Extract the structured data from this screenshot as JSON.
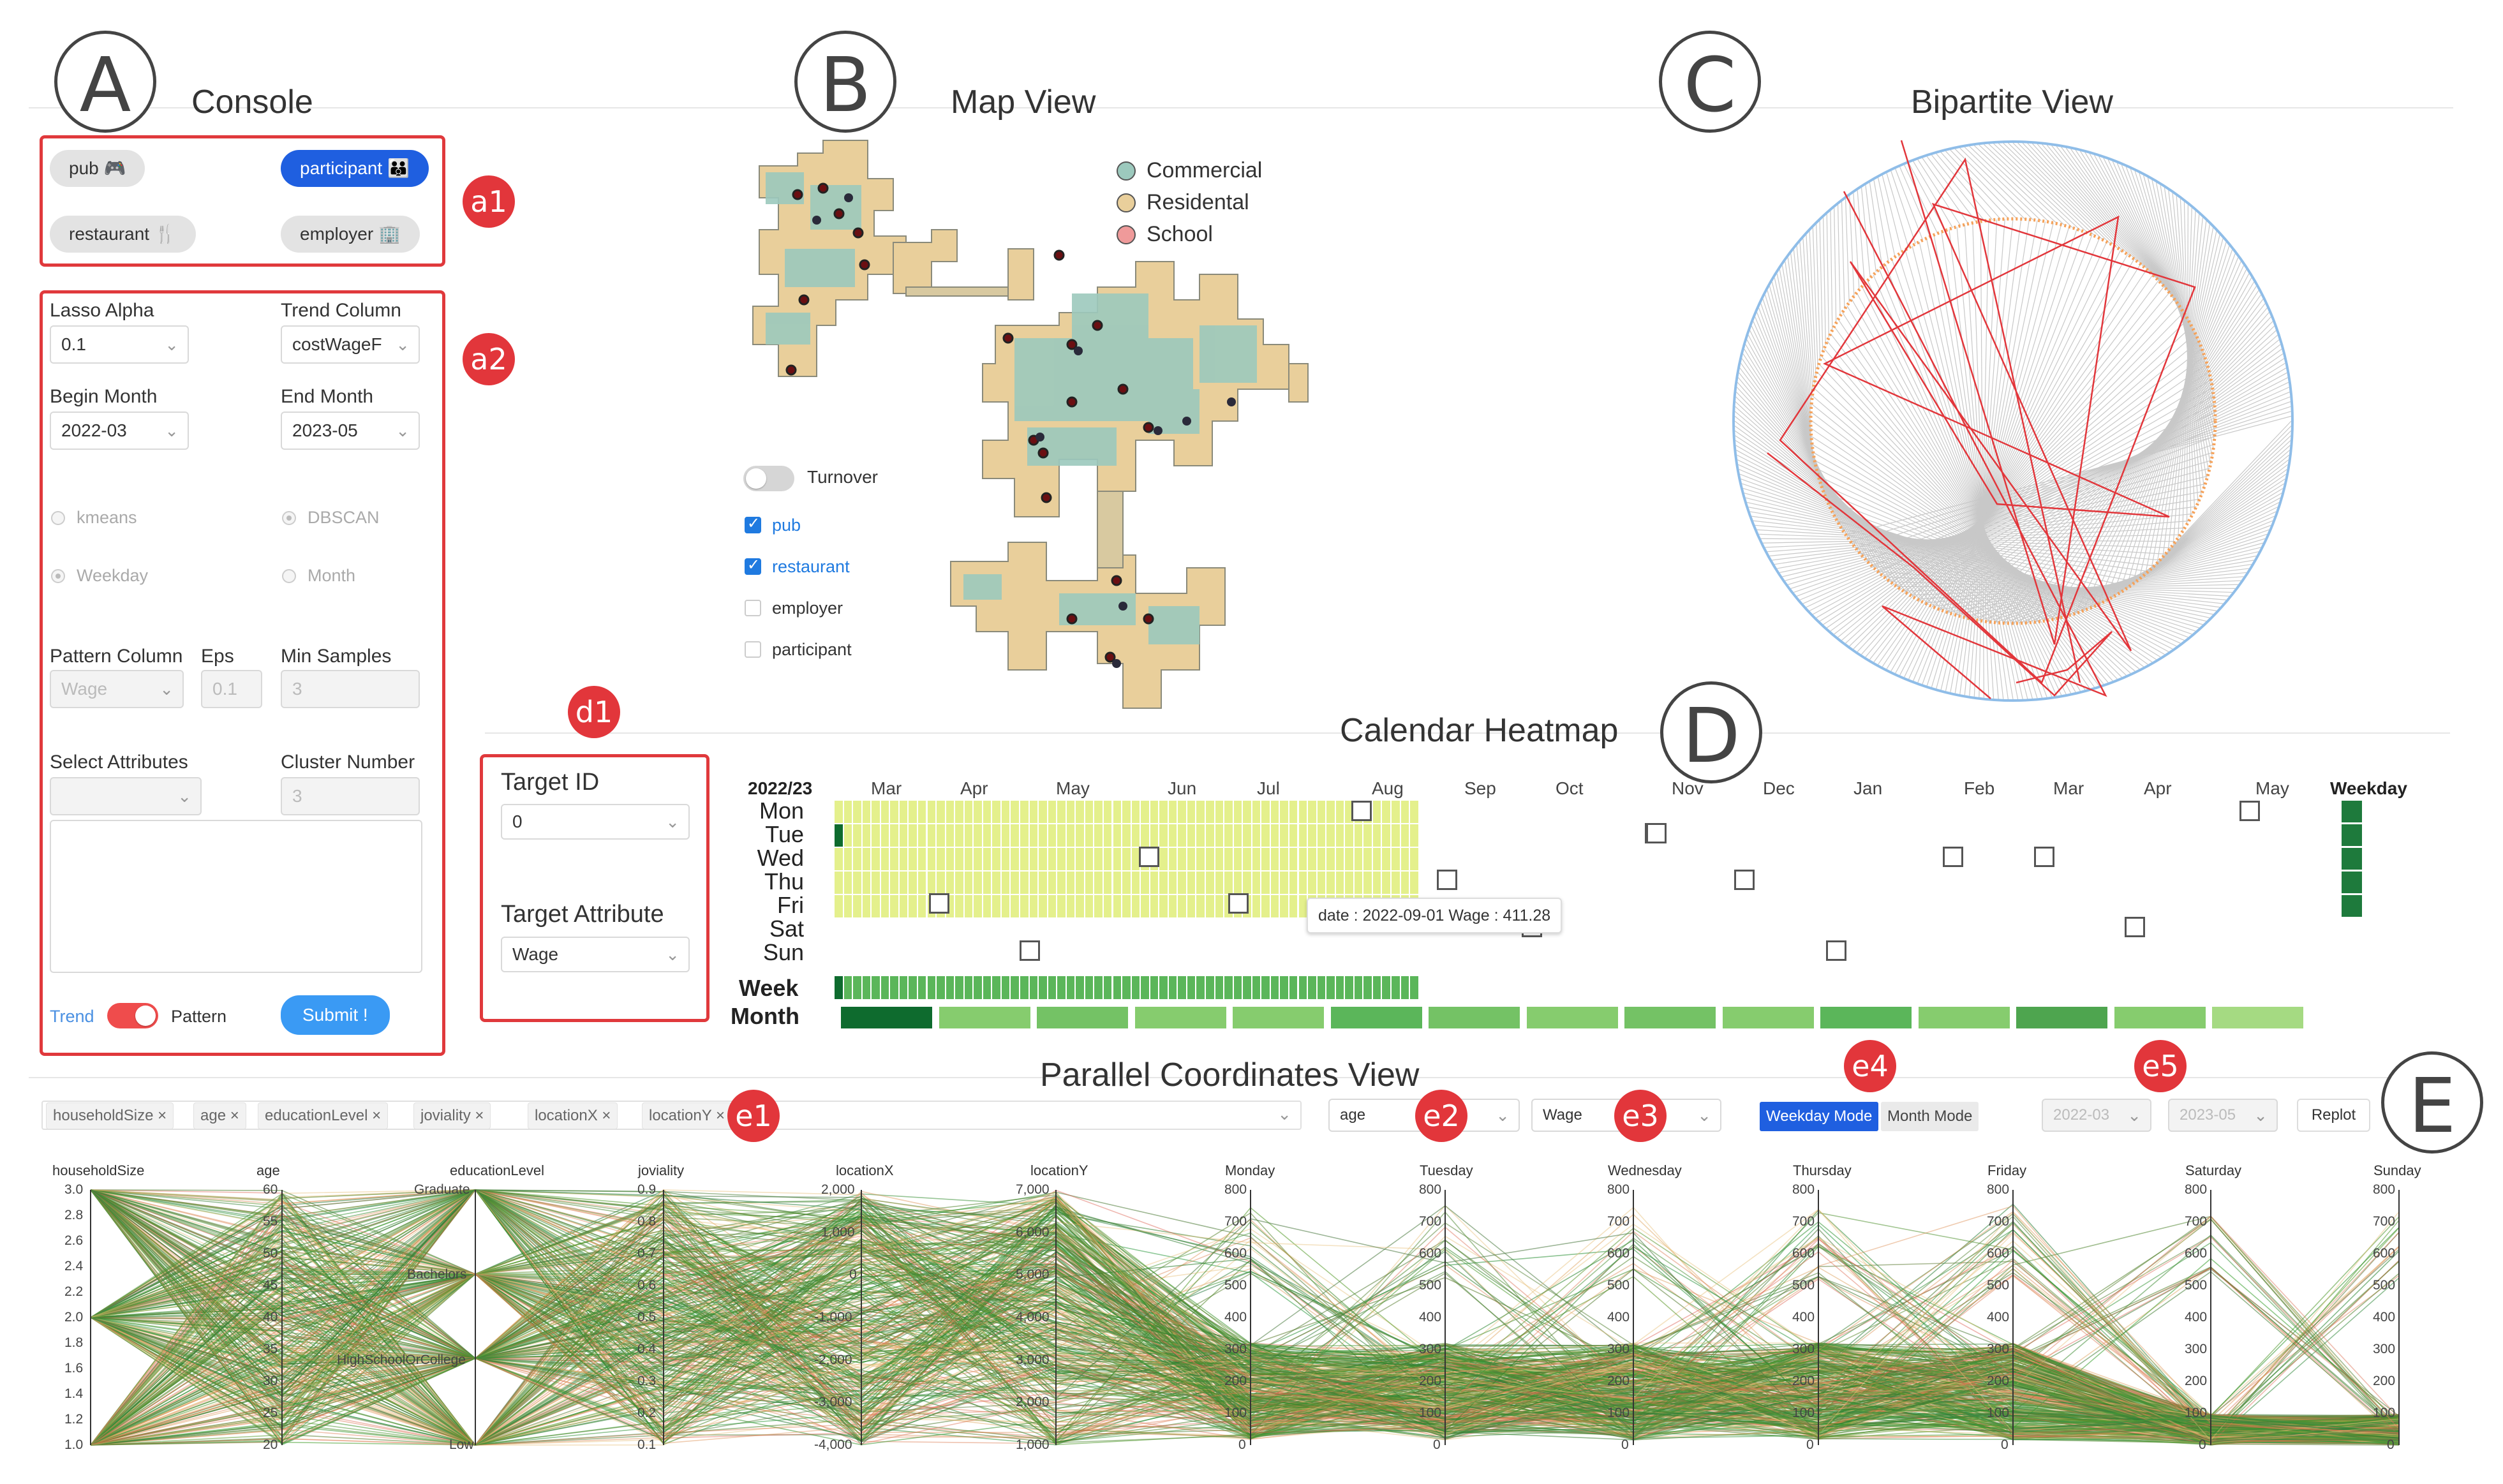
{
  "panels": {
    "A": {
      "letter": "A",
      "title": "Console"
    },
    "B": {
      "letter": "B",
      "title": "Map View"
    },
    "C": {
      "letter": "C",
      "title": "Bipartite View"
    },
    "D": {
      "letter": "D",
      "title": "Calendar Heatmap"
    },
    "E": {
      "letter": "E",
      "title": "Parallel Coordinates View"
    }
  },
  "badges": {
    "a1": "a1",
    "a2": "a2",
    "d1": "d1",
    "e1": "e1",
    "e2": "e2",
    "e3": "e3",
    "e4": "e4",
    "e5": "e5"
  },
  "console": {
    "entity_buttons": [
      {
        "label": "pub 🎮",
        "active": false
      },
      {
        "label": "participant 👪",
        "active": true
      },
      {
        "label": "restaurant 🍴",
        "active": false
      },
      {
        "label": "employer 🏢",
        "active": false
      }
    ],
    "lasso_alpha": {
      "label": "Lasso Alpha",
      "value": "0.1"
    },
    "trend_column": {
      "label": "Trend Column",
      "value": "costWageF"
    },
    "begin_month": {
      "label": "Begin Month",
      "value": "2022-03"
    },
    "end_month": {
      "label": "End Month",
      "value": "2023-05"
    },
    "radios": {
      "kmeans": "kmeans",
      "dbscan": "DBSCAN",
      "weekday": "Weekday",
      "month": "Month"
    },
    "pattern_column": {
      "label": "Pattern Column",
      "value": "Wage"
    },
    "eps": {
      "label": "Eps",
      "value": "0.1"
    },
    "min_samples": {
      "label": "Min Samples",
      "value": "3"
    },
    "select_attributes": {
      "label": "Select Attributes",
      "value": ""
    },
    "cluster_number": {
      "label": "Cluster Number",
      "value": "3"
    },
    "trend_label": "Trend",
    "pattern_label": "Pattern",
    "submit_label": "Submit !"
  },
  "map": {
    "legend": [
      {
        "label": "Commercial",
        "color": "#9cc9bd"
      },
      {
        "label": "Residental",
        "color": "#e9cf9b"
      },
      {
        "label": "School",
        "color": "#ef9a9a"
      }
    ],
    "turnover_label": "Turnover",
    "layers": [
      {
        "label": "pub",
        "checked": true
      },
      {
        "label": "restaurant",
        "checked": true
      },
      {
        "label": "employer",
        "checked": false
      },
      {
        "label": "participant",
        "checked": false
      }
    ]
  },
  "target": {
    "id_label": "Target ID",
    "id_value": "0",
    "attr_label": "Target Attribute",
    "attr_value": "Wage"
  },
  "heatmap": {
    "year_label": "2022/23",
    "months": [
      "Mar",
      "Apr",
      "May",
      "Jun",
      "Jul",
      "Aug",
      "Sep",
      "Oct",
      "Nov",
      "Dec",
      "Jan",
      "Feb",
      "Mar",
      "Apr",
      "May"
    ],
    "days": [
      "Mon",
      "Tue",
      "Wed",
      "Thu",
      "Fri",
      "Sat",
      "Sun"
    ],
    "weekday_label": "Weekday",
    "week_label": "Week",
    "month_label": "Month",
    "tooltip": "date : 2022-09-01 Wage : 411.28"
  },
  "parallel": {
    "tags": [
      "householdSize",
      "age",
      "educationLevel",
      "joviality",
      "locationX",
      "locationY"
    ],
    "color_attr": "age",
    "value_attr": "Wage",
    "mode_weekday": "Weekday Mode",
    "mode_month": "Month Mode",
    "from_month": "2022-03",
    "to_month": "2023-05",
    "replot_label": "Replot",
    "axes": [
      {
        "name": "householdSize",
        "ticks": [
          "3.0",
          "2.8",
          "2.6",
          "2.4",
          "2.2",
          "2.0",
          "1.8",
          "1.6",
          "1.4",
          "1.2",
          "1.0"
        ]
      },
      {
        "name": "age",
        "ticks": [
          "60",
          "55",
          "50",
          "45",
          "40",
          "35",
          "30",
          "25",
          "20"
        ]
      },
      {
        "name": "educationLevel",
        "ticks": [
          "Graduate",
          "Bachelors",
          "HighSchoolOrCollege",
          "Low"
        ]
      },
      {
        "name": "joviality",
        "ticks": [
          "0.9",
          "0.8",
          "0.7",
          "0.6",
          "0.5",
          "0.4",
          "0.3",
          "0.2",
          "0.1"
        ]
      },
      {
        "name": "locationX",
        "ticks": [
          "2,000",
          "1,000",
          "0",
          "-1,000",
          "-2,000",
          "-3,000",
          "-4,000"
        ]
      },
      {
        "name": "locationY",
        "ticks": [
          "7,000",
          "6,000",
          "5,000",
          "4,000",
          "3,000",
          "2,000",
          "1,000"
        ]
      },
      {
        "name": "Monday",
        "ticks": [
          "800",
          "700",
          "600",
          "500",
          "400",
          "300",
          "200",
          "100",
          "0"
        ]
      },
      {
        "name": "Tuesday",
        "ticks": [
          "800",
          "700",
          "600",
          "500",
          "400",
          "300",
          "200",
          "100",
          "0"
        ]
      },
      {
        "name": "Wednesday",
        "ticks": [
          "800",
          "700",
          "600",
          "500",
          "400",
          "300",
          "200",
          "100",
          "0"
        ]
      },
      {
        "name": "Thursday",
        "ticks": [
          "800",
          "700",
          "600",
          "500",
          "400",
          "300",
          "200",
          "100",
          "0"
        ]
      },
      {
        "name": "Friday",
        "ticks": [
          "800",
          "700",
          "600",
          "500",
          "400",
          "300",
          "200",
          "100",
          "0"
        ]
      },
      {
        "name": "Saturday",
        "ticks": [
          "800",
          "700",
          "600",
          "500",
          "400",
          "300",
          "200",
          "100",
          "0"
        ]
      },
      {
        "name": "Sunday",
        "ticks": [
          "800",
          "700",
          "600",
          "500",
          "400",
          "300",
          "200",
          "100",
          "0"
        ]
      }
    ]
  }
}
